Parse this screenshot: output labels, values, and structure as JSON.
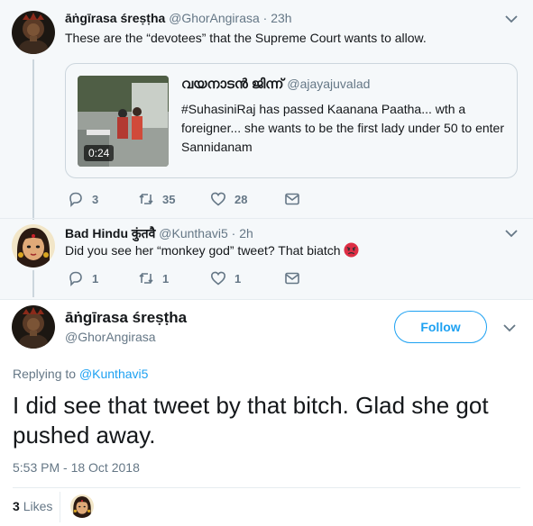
{
  "tweet1": {
    "name": "āṅgīrasa śreṣṭha",
    "handle": "@GhorAngirasa",
    "dot": "·",
    "time": "23h",
    "text": "These are the “devotees” that the Supreme Court wants to allow.",
    "quote": {
      "name": "വയനാടൻ ജിന്ന്",
      "handle": "@ajayajuvalad",
      "text": "#SuhasiniRaj has passed Kaanana Paatha... wth a foreigner... she wants to be the first lady under 50 to enter Sannidanam",
      "video_duration": "0:24"
    },
    "stats": {
      "replies": "3",
      "retweets": "35",
      "likes": "28"
    }
  },
  "tweet2": {
    "name": "Bad Hindu कुंतवै",
    "handle": "@Kunthavi5",
    "dot": "·",
    "time": "2h",
    "text": "Did you see her “monkey god” tweet? That biatch",
    "emoji": "angry-face",
    "stats": {
      "replies": "1",
      "retweets": "1",
      "likes": "1"
    }
  },
  "main_tweet": {
    "name": "āṅgīrasa śreṣṭha",
    "handle": "@GhorAngirasa",
    "follow_label": "Follow",
    "replying_prefix": "Replying to",
    "replying_to": "@Kunthavi5",
    "text": "I did see that tweet by that bitch. Glad she got pushed away.",
    "timestamp": "5:53 PM - 18 Oct 2018",
    "likes_count": "3",
    "likes_label": "Likes"
  },
  "colors": {
    "accent": "#1da1f2",
    "muted": "#657786",
    "thread_bg": "#f5f8fa",
    "border": "#e6ecf0"
  }
}
